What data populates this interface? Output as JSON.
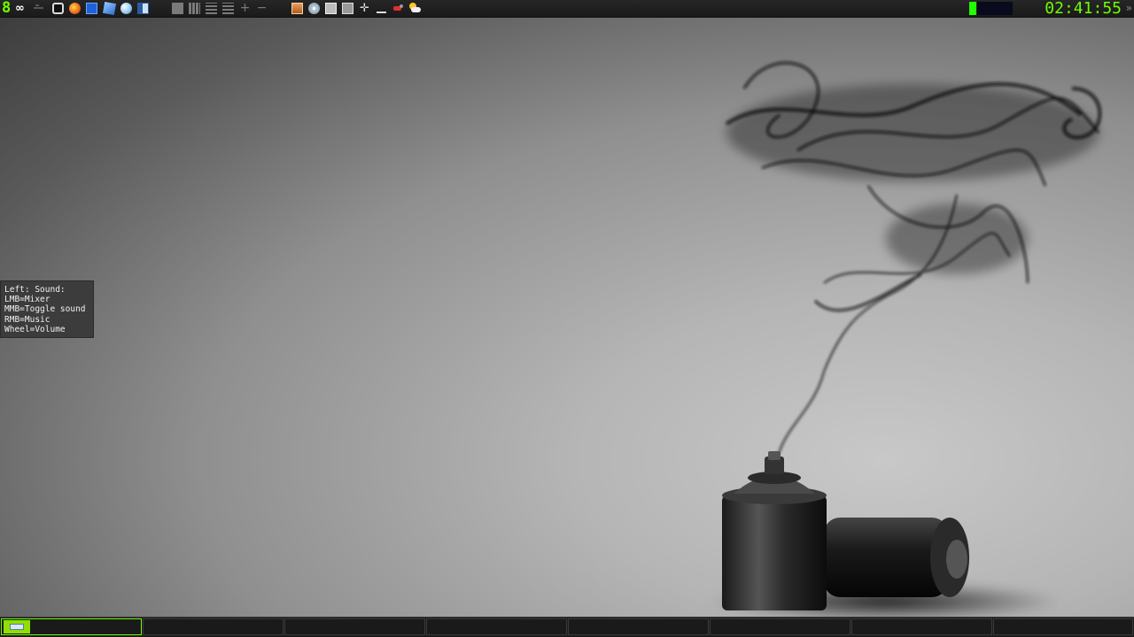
{
  "top_panel": {
    "workspace_number": "8",
    "clock": "02:41:55",
    "launchers": [
      "infinity-icon",
      "tray-toggle-icon",
      "terminal-icon",
      "firefox-icon",
      "file-manager-icon",
      "package-icon",
      "browser-globe-icon",
      "text-editor-icon"
    ],
    "layout_buttons": [
      "layout-floating-icon",
      "layout-tile-icon",
      "layout-rows-icon",
      "layout-stacked-icon",
      "add-window-icon",
      "remove-window-icon"
    ],
    "tray_icons": [
      "archive-icon",
      "disk-icon",
      "mail-icon",
      "image-viewer-icon",
      "move-icon",
      "minimize-icon",
      "network-icon",
      "weather-icon"
    ]
  },
  "tooltip": {
    "line1": "Left: Sound:",
    "line2": "LMB=Mixer",
    "line3": "MMB=Toggle sound",
    "line4": "RMB=Music",
    "line5": "Wheel=Volume"
  },
  "taskbar": {
    "slot_count": 8,
    "active_slot": 0
  },
  "colors": {
    "accent": "#6cff00",
    "panel_bg": "#1c1c1c",
    "tooltip_bg": "#3c3c3c"
  }
}
